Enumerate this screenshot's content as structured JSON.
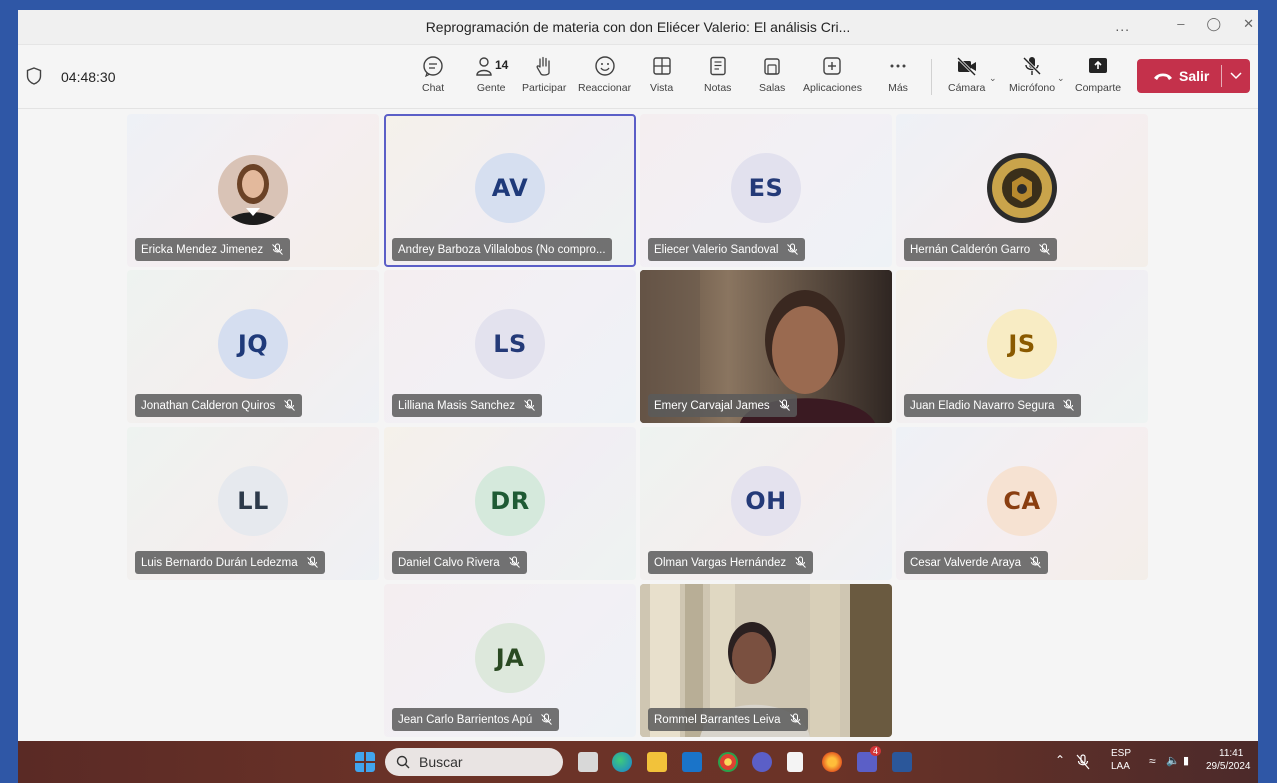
{
  "window": {
    "title": "Reprogramación de materia con don Eliécer Valerio: El análisis Cri...",
    "more": "..."
  },
  "toolbar": {
    "timer": "04:48:30",
    "people_count": "14",
    "buttons": [
      {
        "label": "Chat",
        "icon": "chat-icon"
      },
      {
        "label": "Gente",
        "icon": "people-icon"
      },
      {
        "label": "Participar",
        "icon": "raise-hand-icon"
      },
      {
        "label": "Reaccionar",
        "icon": "smiley-icon"
      },
      {
        "label": "Vista",
        "icon": "grid-view-icon"
      },
      {
        "label": "Notas",
        "icon": "notes-icon"
      },
      {
        "label": "Salas",
        "icon": "rooms-icon"
      },
      {
        "label": "Aplicaciones",
        "icon": "add-app-icon"
      },
      {
        "label": "Más",
        "icon": "more-icon"
      },
      {
        "label": "Cámara",
        "icon": "camera-off-icon"
      },
      {
        "label": "Micrófono",
        "icon": "mic-off-icon"
      },
      {
        "label": "Comparte",
        "icon": "share-icon"
      }
    ],
    "leave_label": "Salir"
  },
  "participants": [
    {
      "name": "Ericka Mendez Jimenez",
      "type": "photo"
    },
    {
      "name": "Andrey Barboza Villalobos (No compro...",
      "initials": "AV",
      "avatar_bg": "#d6dff0",
      "avatar_fg": "#1f3a7a",
      "selected": true
    },
    {
      "name": "Eliecer Valerio Sandoval",
      "initials": "ES",
      "avatar_bg": "#e2e1ee",
      "avatar_fg": "#243a78"
    },
    {
      "name": "Hernán Calderón Garro",
      "type": "logo"
    },
    {
      "name": "Jonathan Calderon Quiros",
      "initials": "JQ",
      "avatar_bg": "#d5def0",
      "avatar_fg": "#1f3a7a"
    },
    {
      "name": "Lilliana Masis Sanchez",
      "initials": "LS",
      "avatar_bg": "#e3e2ee",
      "avatar_fg": "#243a78"
    },
    {
      "name": "Emery Carvajal James",
      "type": "video"
    },
    {
      "name": "Juan Eladio Navarro Segura",
      "initials": "JS",
      "avatar_bg": "#f8ecc4",
      "avatar_fg": "#8a5a00"
    },
    {
      "name": "Luis Bernardo Durán Ledezma",
      "initials": "LL",
      "avatar_bg": "#e6e9ee",
      "avatar_fg": "#2d3a4a"
    },
    {
      "name": "Daniel Calvo Rivera",
      "initials": "DR",
      "avatar_bg": "#d5e9dc",
      "avatar_fg": "#1e5a34"
    },
    {
      "name": "Olman Vargas Hernández",
      "initials": "OH",
      "avatar_bg": "#e4e2ee",
      "avatar_fg": "#243a78"
    },
    {
      "name": "Cesar Valverde Araya",
      "initials": "CA",
      "avatar_bg": "#f6e2d2",
      "avatar_fg": "#8a3e10"
    },
    {
      "name": "Jean Carlo Barrientos Apú",
      "initials": "JA",
      "avatar_bg": "#dde8dc",
      "avatar_fg": "#2a4a22"
    },
    {
      "name": "Rommel Barrantes Leiva",
      "type": "video"
    }
  ],
  "taskbar": {
    "search_label": "Buscar",
    "teams_badge": "4",
    "lang": "ESP",
    "lang_sub": "LAA",
    "time": "11:41",
    "date": "29/5/2024"
  }
}
